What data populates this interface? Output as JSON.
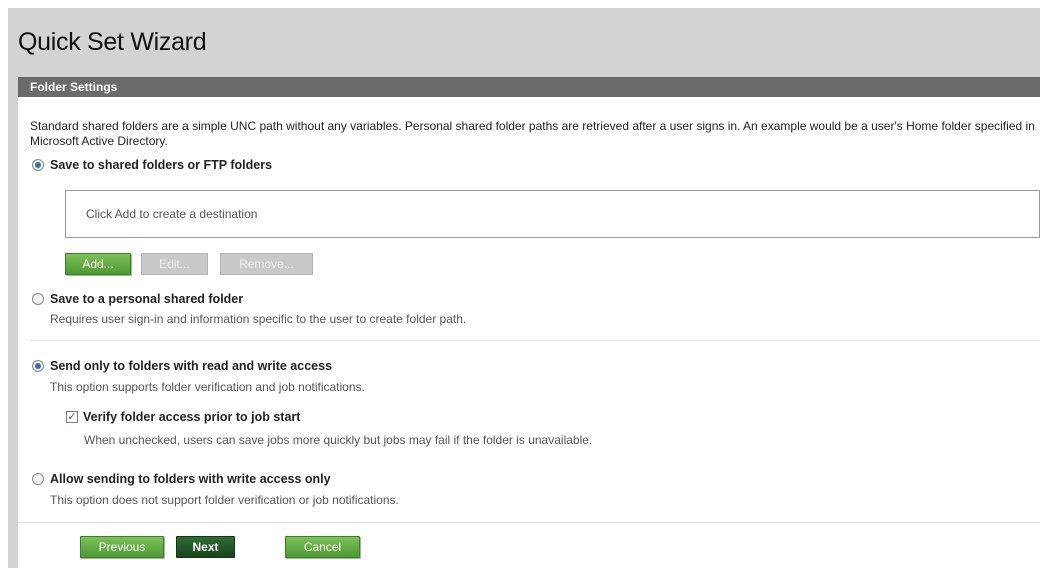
{
  "window": {
    "title": "Quick Set Wizard"
  },
  "section": {
    "title": "Folder Settings"
  },
  "intro": "Standard shared folders are a simple UNC path without any variables. Personal shared folder paths are retrieved after a user signs in. An example would be a user's Home folder specified in Microsoft Active Directory.",
  "options": {
    "shared": {
      "label": "Save to shared folders or FTP folders",
      "checked": true
    },
    "destination_placeholder": "Click Add to create a destination",
    "buttons": {
      "add": "Add...",
      "edit": "Edit...",
      "remove": "Remove..."
    },
    "personal": {
      "label": "Save to a personal shared folder",
      "desc": "Requires user sign-in and information specific to the user to create folder path.",
      "checked": false
    },
    "readwrite": {
      "label": "Send only to folders with read and write access",
      "desc": "This option supports folder verification and job notifications.",
      "checked": true
    },
    "verify": {
      "label": "Verify folder access prior to job start",
      "desc": "When unchecked, users can save jobs more quickly but jobs may fail if the folder is unavailable.",
      "checked": true,
      "check_glyph": "✓"
    },
    "writeonly": {
      "label": "Allow sending to folders with write access only",
      "desc": "This option does not support folder verification or job notifications.",
      "checked": false
    }
  },
  "footer": {
    "previous": "Previous",
    "next": "Next",
    "cancel": "Cancel"
  }
}
